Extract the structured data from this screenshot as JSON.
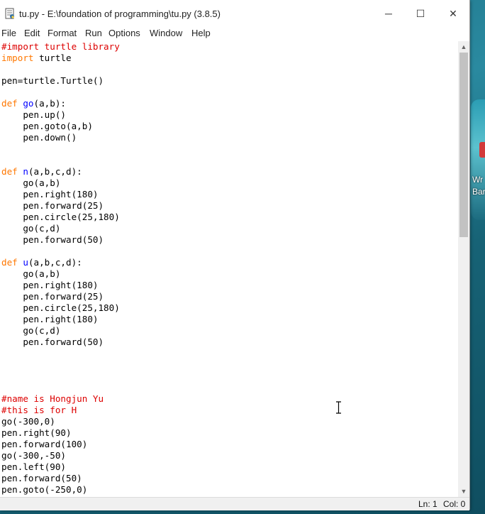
{
  "window": {
    "title": "tu.py - E:\\foundation of programming\\tu.py (3.8.5)",
    "controls": {
      "minimize": "─",
      "maximize": "☐",
      "close": "✕"
    }
  },
  "menu": [
    "File",
    "Edit",
    "Format",
    "Run",
    "Options",
    "Window",
    "Help"
  ],
  "editor": {
    "lines": [
      {
        "segments": [
          {
            "t": "#import turtle library",
            "c": "cm"
          }
        ]
      },
      {
        "segments": [
          {
            "t": "import",
            "c": "kw"
          },
          {
            "t": " turtle",
            "c": ""
          }
        ]
      },
      {
        "segments": []
      },
      {
        "segments": [
          {
            "t": "pen=turtle.Turtle()",
            "c": ""
          }
        ]
      },
      {
        "segments": []
      },
      {
        "segments": [
          {
            "t": "def",
            "c": "kw"
          },
          {
            "t": " ",
            "c": ""
          },
          {
            "t": "go",
            "c": "fn"
          },
          {
            "t": "(a,b):",
            "c": ""
          }
        ]
      },
      {
        "segments": [
          {
            "t": "    pen.up()",
            "c": ""
          }
        ]
      },
      {
        "segments": [
          {
            "t": "    pen.goto(a,b)",
            "c": ""
          }
        ]
      },
      {
        "segments": [
          {
            "t": "    pen.down()",
            "c": ""
          }
        ]
      },
      {
        "segments": []
      },
      {
        "segments": []
      },
      {
        "segments": [
          {
            "t": "def",
            "c": "kw"
          },
          {
            "t": " ",
            "c": ""
          },
          {
            "t": "n",
            "c": "fn"
          },
          {
            "t": "(a,b,c,d):",
            "c": ""
          }
        ]
      },
      {
        "segments": [
          {
            "t": "    go(a,b)",
            "c": ""
          }
        ]
      },
      {
        "segments": [
          {
            "t": "    pen.right(180)",
            "c": ""
          }
        ]
      },
      {
        "segments": [
          {
            "t": "    pen.forward(25)",
            "c": ""
          }
        ]
      },
      {
        "segments": [
          {
            "t": "    pen.circle(25,180)",
            "c": ""
          }
        ]
      },
      {
        "segments": [
          {
            "t": "    go(c,d)",
            "c": ""
          }
        ]
      },
      {
        "segments": [
          {
            "t": "    pen.forward(50)",
            "c": ""
          }
        ]
      },
      {
        "segments": []
      },
      {
        "segments": [
          {
            "t": "def",
            "c": "kw"
          },
          {
            "t": " ",
            "c": ""
          },
          {
            "t": "u",
            "c": "fn"
          },
          {
            "t": "(a,b,c,d):",
            "c": ""
          }
        ]
      },
      {
        "segments": [
          {
            "t": "    go(a,b)",
            "c": ""
          }
        ]
      },
      {
        "segments": [
          {
            "t": "    pen.right(180)",
            "c": ""
          }
        ]
      },
      {
        "segments": [
          {
            "t": "    pen.forward(25)",
            "c": ""
          }
        ]
      },
      {
        "segments": [
          {
            "t": "    pen.circle(25,180)",
            "c": ""
          }
        ]
      },
      {
        "segments": [
          {
            "t": "    pen.right(180)",
            "c": ""
          }
        ]
      },
      {
        "segments": [
          {
            "t": "    go(c,d)",
            "c": ""
          }
        ]
      },
      {
        "segments": [
          {
            "t": "    pen.forward(50)",
            "c": ""
          }
        ]
      },
      {
        "segments": []
      },
      {
        "segments": []
      },
      {
        "segments": []
      },
      {
        "segments": []
      },
      {
        "segments": [
          {
            "t": "#name is Hongjun Yu",
            "c": "cm"
          }
        ]
      },
      {
        "segments": [
          {
            "t": "#this is for H",
            "c": "cm"
          }
        ]
      },
      {
        "segments": [
          {
            "t": "go(-300,0)",
            "c": ""
          }
        ]
      },
      {
        "segments": [
          {
            "t": "pen.right(90)",
            "c": ""
          }
        ]
      },
      {
        "segments": [
          {
            "t": "pen.forward(100)",
            "c": ""
          }
        ]
      },
      {
        "segments": [
          {
            "t": "go(-300,-50)",
            "c": ""
          }
        ]
      },
      {
        "segments": [
          {
            "t": "pen.left(90)",
            "c": ""
          }
        ]
      },
      {
        "segments": [
          {
            "t": "pen.forward(50)",
            "c": ""
          }
        ]
      },
      {
        "segments": [
          {
            "t": "pen.goto(-250,0)",
            "c": ""
          }
        ]
      }
    ]
  },
  "status": {
    "line": "Ln: 1",
    "col": "Col: 0"
  },
  "desktop": {
    "icon_text_1": "Wr",
    "icon_text_2": "Bar"
  }
}
